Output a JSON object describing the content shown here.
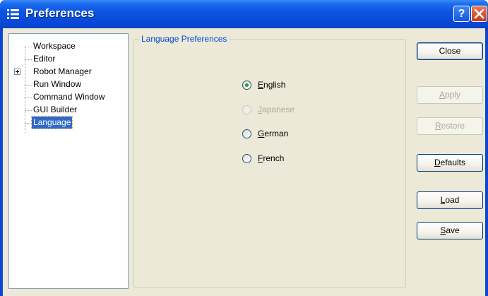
{
  "window": {
    "title": "Preferences"
  },
  "titlebar_buttons": {
    "help": "?",
    "close": "close-icon"
  },
  "tree": {
    "items": [
      {
        "label": "Workspace",
        "expandable": false
      },
      {
        "label": "Editor",
        "expandable": false
      },
      {
        "label": "Robot Manager",
        "expandable": true
      },
      {
        "label": "Run Window",
        "expandable": false
      },
      {
        "label": "Command Window",
        "expandable": false
      },
      {
        "label": "GUI Builder",
        "expandable": false
      },
      {
        "label": "Language",
        "expandable": false,
        "selected": true
      }
    ]
  },
  "group": {
    "legend": "Language Preferences",
    "options": [
      {
        "label": "English",
        "mnemonic": "E",
        "rest": "nglish",
        "checked": true,
        "enabled": true
      },
      {
        "label": "Japanese",
        "mnemonic": "J",
        "rest": "apanese",
        "checked": false,
        "enabled": false
      },
      {
        "label": "German",
        "mnemonic": "G",
        "rest": "erman",
        "checked": false,
        "enabled": true
      },
      {
        "label": "French",
        "mnemonic": "F",
        "rest": "rench",
        "checked": false,
        "enabled": true
      }
    ]
  },
  "buttons": {
    "close": {
      "label": "Close",
      "enabled": true
    },
    "apply": {
      "mnemonic": "A",
      "rest": "pply",
      "enabled": false
    },
    "restore": {
      "mnemonic": "R",
      "rest": "estore",
      "enabled": false
    },
    "defaults": {
      "mnemonic": "D",
      "rest": "efaults",
      "enabled": true
    },
    "load": {
      "mnemonic": "L",
      "rest": "oad",
      "enabled": true
    },
    "save": {
      "mnemonic": "S",
      "rest": "ave",
      "enabled": true
    }
  },
  "colors": {
    "titlebar": "#0a55e2",
    "selection": "#316ac5",
    "legend_text": "#0046d5",
    "radio_dot": "#21a121",
    "dialog_bg": "#ece9d8"
  }
}
